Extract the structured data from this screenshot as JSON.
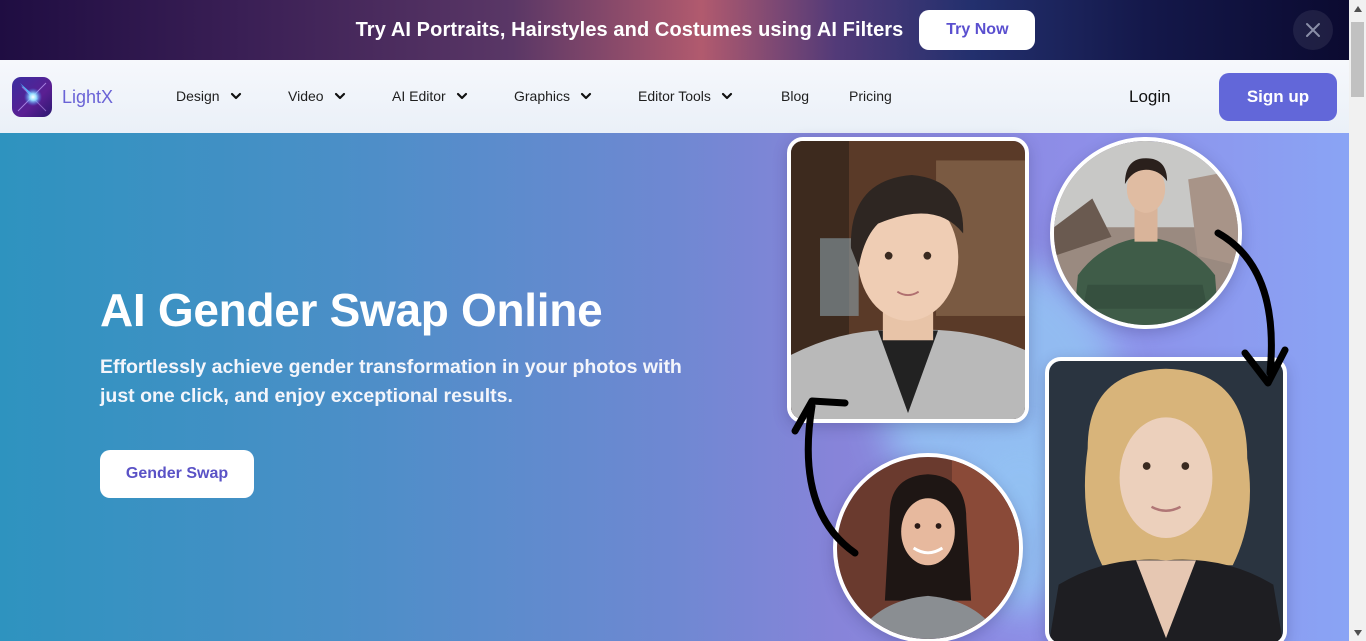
{
  "promo": {
    "text": "Try AI Portraits, Hairstyles and Costumes using AI Filters",
    "button_label": "Try Now",
    "close_icon": "close-icon"
  },
  "nav": {
    "brand": "LightX",
    "logo_icon": "lightx-logo-icon",
    "items": [
      {
        "label": "Design",
        "has_dropdown": true
      },
      {
        "label": "Video",
        "has_dropdown": true
      },
      {
        "label": "AI Editor",
        "has_dropdown": true
      },
      {
        "label": "Graphics",
        "has_dropdown": true
      },
      {
        "label": "Editor Tools",
        "has_dropdown": true
      },
      {
        "label": "Blog",
        "has_dropdown": false
      },
      {
        "label": "Pricing",
        "has_dropdown": false
      }
    ],
    "login_label": "Login",
    "signup_label": "Sign up"
  },
  "hero": {
    "title": "AI Gender Swap Online",
    "subtitle": "Effortlessly achieve gender transformation in your photos with just one click, and enjoy exceptional results.",
    "cta_label": "Gender Swap",
    "images": [
      {
        "name": "swapped-female-to-male-photo",
        "description": "Short-haired person in grey patterned shirt"
      },
      {
        "name": "original-male-photo",
        "description": "Man in green hoodie with crossed arms"
      },
      {
        "name": "original-female-photo",
        "description": "Smiling woman with long dark hair"
      },
      {
        "name": "swapped-male-to-female-photo",
        "description": "Woman with wavy blonde hair"
      }
    ]
  },
  "colors": {
    "accent": "#6267d9",
    "brand_text": "#6a63d6",
    "cta_text": "#5a52c6"
  }
}
